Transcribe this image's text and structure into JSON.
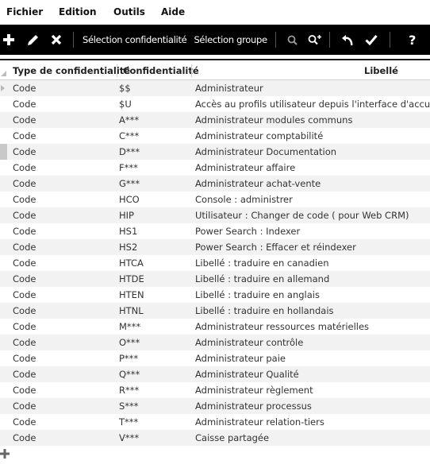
{
  "menu": [
    {
      "label": "Fichier",
      "icon": "file"
    },
    {
      "label": "Edition",
      "icon": "edit"
    },
    {
      "label": "Outils",
      "icon": "tools"
    },
    {
      "label": "Aide",
      "icon": "help"
    }
  ],
  "toolbar": {
    "selection_confidentialite": "Sélection confidentialité",
    "selection_groupe": "Sélection groupe",
    "icons": [
      "add-icon",
      "edit-pencil-icon",
      "delete-x-icon",
      "search-icon",
      "search-plus-icon",
      "undo-icon",
      "confirm-check-icon",
      "help-question-icon"
    ]
  },
  "table": {
    "columns": [
      "Type de confidentialité",
      "Confidentialité",
      "Libellé"
    ],
    "rows": [
      [
        "Code",
        "$$",
        "Administrateur"
      ],
      [
        "Code",
        "$U",
        "Accès au profils utilisateur depuis l'interface d'accueil"
      ],
      [
        "Code",
        "A***",
        "Administrateur modules communs"
      ],
      [
        "Code",
        "C***",
        "Administrateur comptabilité"
      ],
      [
        "Code",
        "D***",
        "Administrateur Documentation"
      ],
      [
        "Code",
        "F***",
        "Administrateur affaire"
      ],
      [
        "Code",
        "G***",
        "Administrateur achat-vente"
      ],
      [
        "Code",
        "HCO",
        "Console : administrer"
      ],
      [
        "Code",
        "HIP",
        "Utilisateur : Changer de code ( pour Web CRM)"
      ],
      [
        "Code",
        "HS1",
        "Power Search : Indexer"
      ],
      [
        "Code",
        "HS2",
        "Power Search : Effacer et réindexer"
      ],
      [
        "Code",
        "HTCA",
        "Libellé : traduire en canadien"
      ],
      [
        "Code",
        "HTDE",
        "Libellé : traduire en allemand"
      ],
      [
        "Code",
        "HTEN",
        "Libellé : traduire en anglais"
      ],
      [
        "Code",
        "HTNL",
        "Libellé : traduire en hollandais"
      ],
      [
        "Code",
        "M***",
        "Administrateur ressources matérielles"
      ],
      [
        "Code",
        "O***",
        "Administrateur contrôle"
      ],
      [
        "Code",
        "P***",
        "Administrateur paie"
      ],
      [
        "Code",
        "Q***",
        "Administrateur Qualité"
      ],
      [
        "Code",
        "R***",
        "Administrateur règlement"
      ],
      [
        "Code",
        "S***",
        "Administrateur processus"
      ],
      [
        "Code",
        "T***",
        "Administrateur relation-tiers"
      ],
      [
        "Code",
        "V***",
        "Caisse partagée"
      ]
    ]
  },
  "colors": {
    "toolbar_bg": "#000000",
    "row_alt": "#f2f2f2",
    "indicator": "#c8c8c8"
  }
}
